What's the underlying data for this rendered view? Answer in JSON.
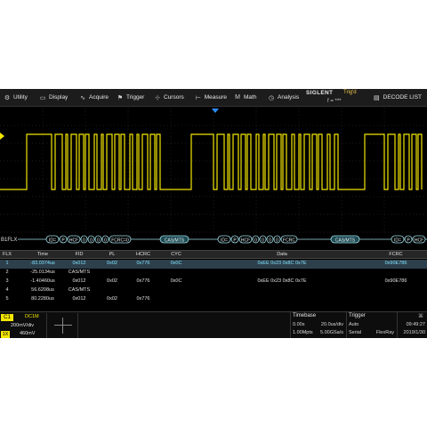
{
  "menu": {
    "items": [
      {
        "label": "Utility",
        "icon": "wrench-icon"
      },
      {
        "label": "Display",
        "icon": "monitor-icon"
      },
      {
        "label": "Acquire",
        "icon": "acquire-icon"
      },
      {
        "label": "Trigger",
        "icon": "trigger-flag-icon"
      },
      {
        "label": "Cursors",
        "icon": "cursors-icon"
      },
      {
        "label": "Measure",
        "icon": "ruler-icon"
      },
      {
        "label": "Math",
        "icon": "math-icon"
      },
      {
        "label": "Analysis",
        "icon": "analysis-icon"
      }
    ],
    "brand": "SIGLENT",
    "trig_status": "Trig'd",
    "freq": "f = ***",
    "decode_label": "DECODE LIST"
  },
  "bus": {
    "label": "B1FLX",
    "frames": [
      {
        "fields": [
          "ID=",
          "P",
          "HCF",
          "0",
          "0",
          "0",
          "0",
          "FCRC=0"
        ],
        "marker": "CAS/MTS"
      },
      {
        "fields": [
          "ID=",
          "P",
          "HCF",
          "0",
          "0",
          "0",
          "0",
          "FCRC"
        ],
        "marker": "CAS/MTS"
      },
      {
        "fields": [
          "ID=",
          "P",
          "HCF"
        ]
      }
    ]
  },
  "table": {
    "headers": [
      "FLX",
      "Time",
      "FID",
      "PL",
      "HCRC",
      "CYC",
      "Data",
      "FCRC"
    ],
    "rows": [
      [
        "1",
        "-83.0374us",
        "0x012",
        "0x02",
        "0x776",
        "0x0C",
        "0xEE 0x23 0x8C 0x7E",
        "0x90E786"
      ],
      [
        "2",
        "-25.0134us",
        "CAS/MTS",
        "",
        "",
        "",
        "",
        ""
      ],
      [
        "3",
        "-1.40460us",
        "0x012",
        "0x02",
        "0x776",
        "0x0C",
        "0xEE 0x23 0x8C 0x7E",
        "0x90E786"
      ],
      [
        "4",
        "56.6208us",
        "CAS/MTS",
        "",
        "",
        "",
        "",
        ""
      ],
      [
        "5",
        "80.2280us",
        "0x012",
        "0x02",
        "0x776",
        "",
        "",
        ""
      ]
    ]
  },
  "channel": {
    "name": "C1",
    "coupling": "DC1M",
    "vdiv": "200mV/div",
    "probe": "1X",
    "offset": "460mV"
  },
  "timebase": {
    "title": "Timebase",
    "delay": "0.00s",
    "tdiv": "20.0us/div",
    "mem": "1.00Mpts",
    "srate": "5.00GSa/s"
  },
  "trigger": {
    "title": "Trigger",
    "mode": "Auto",
    "type": "Serial",
    "source": "FlexRay"
  },
  "clock": {
    "time": "09:49:27",
    "date": "2019/1/30"
  },
  "colors": {
    "trace": "#f2e600",
    "bus": "#9fdde8",
    "grid": "#3a3a3a",
    "trigger_marker": "#2b8cff"
  }
}
